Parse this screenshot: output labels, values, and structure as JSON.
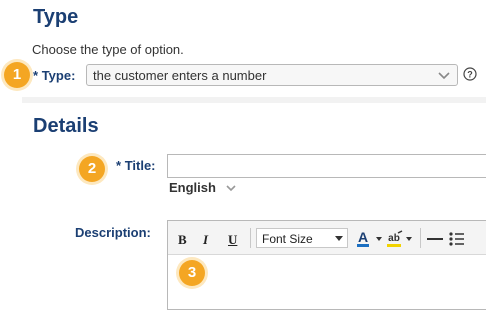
{
  "type_section": {
    "title": "Type",
    "description": "Choose the type of option.",
    "field_label": "Type:",
    "required_marker": "*",
    "selected_value": "the customer enters a number"
  },
  "details_section": {
    "title": "Details",
    "title_field_label": "Title:",
    "title_required_marker": "*",
    "title_value": "",
    "language": "English",
    "description_label": "Description:"
  },
  "editor_toolbar": {
    "bold": "B",
    "italic": "I",
    "underline": "U",
    "font_size_label": "Font Size"
  },
  "badges": [
    "1",
    "2",
    "3"
  ],
  "colors": {
    "heading": "#1b3f73",
    "badge": "#f4a623"
  }
}
